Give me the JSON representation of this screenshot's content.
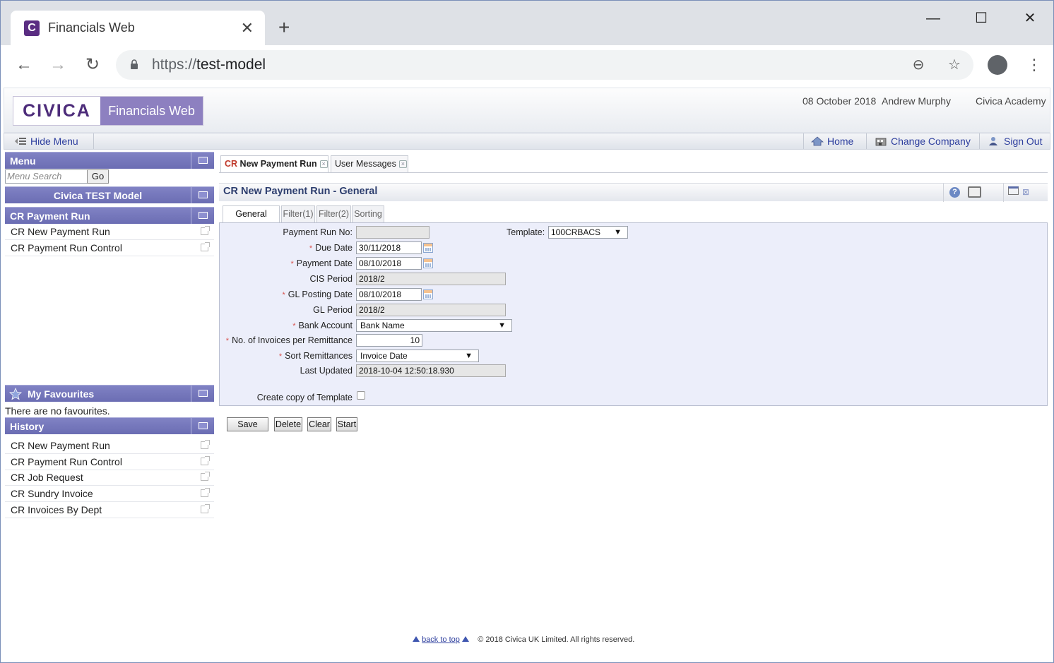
{
  "browser": {
    "tab_title": "Financials Web",
    "favicon_letter": "C",
    "url_scheme": "https://",
    "url_host": "test-model"
  },
  "header": {
    "logo_left": "CIVICA",
    "logo_right": "Financials Web",
    "date": "08 October 2018",
    "user": "Andrew Murphy",
    "company": "Civica Academy"
  },
  "toolbar": {
    "hide_menu": "Hide Menu",
    "home": "Home",
    "change_company": "Change Company",
    "sign_out": "Sign Out"
  },
  "sidebar": {
    "menu_title": "Menu",
    "search_placeholder": "Menu Search",
    "go_label": "Go",
    "model_title": "Civica TEST Model",
    "group_title": "CR Payment Run",
    "group_items": [
      "CR New Payment Run",
      "CR Payment Run Control"
    ],
    "favourites_title": "My Favourites",
    "favourites_empty": "There are no favourites.",
    "history_title": "History",
    "history_items": [
      "CR New Payment Run",
      "CR Payment Run Control",
      "CR Job Request",
      "CR Sundry Invoice",
      "CR Invoices By Dept"
    ]
  },
  "doc_tabs": {
    "active_prefix": "CR",
    "active_rest": " New Payment Run",
    "second": "User Messages"
  },
  "page": {
    "title": "CR New Payment Run - General",
    "sub_tabs": [
      "General",
      "Filter(1)",
      "Filter(2)",
      "Sorting"
    ]
  },
  "form": {
    "payment_run_no": {
      "label": "Payment Run No:",
      "value": ""
    },
    "template": {
      "label": "Template:",
      "value": "100CRBACS"
    },
    "due_date": {
      "label": "Due Date",
      "value": "30/11/2018"
    },
    "payment_date": {
      "label": "Payment Date",
      "value": "08/10/2018"
    },
    "cis_period": {
      "label": "CIS Period",
      "value": "2018/2"
    },
    "gl_posting_date": {
      "label": "GL Posting Date",
      "value": "08/10/2018"
    },
    "gl_period": {
      "label": "GL Period",
      "value": "2018/2"
    },
    "bank_account": {
      "label": "Bank Account",
      "value": "Bank Name"
    },
    "invoices_per_remittance": {
      "label": "No. of Invoices per Remittance",
      "value": "10"
    },
    "sort_remittances": {
      "label": "Sort Remittances",
      "value": "Invoice Date"
    },
    "last_updated": {
      "label": "Last Updated",
      "value": "2018-10-04 12:50:18.930"
    },
    "create_copy": {
      "label": "Create copy of Template",
      "checked": false
    },
    "required_mark": "*"
  },
  "actions": {
    "save": "Save",
    "delete": "Delete",
    "clear": "Clear",
    "start": "Start"
  },
  "footer": {
    "back_to_top": "back to top",
    "copyright": "© 2018 Civica UK Limited. All rights reserved."
  },
  "colors": {
    "panel_header": "#6b6db3",
    "brand_purple": "#5a2d82",
    "link": "#2d3e9e",
    "required": "#d9534f"
  }
}
